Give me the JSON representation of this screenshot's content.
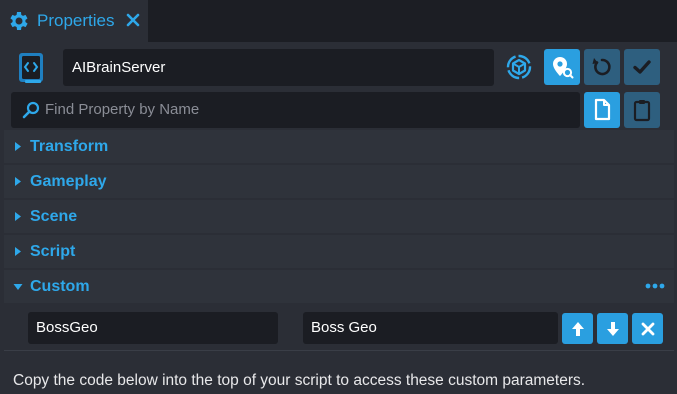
{
  "tab": {
    "title": "Properties",
    "icon": "gear-icon",
    "accent": "#2ea8ea"
  },
  "object": {
    "name": "AIBrainServer",
    "icon": "script-icon"
  },
  "toolbar": {
    "buttons": [
      {
        "icon": "locate-pin-icon",
        "state": "active"
      },
      {
        "icon": "reset-icon",
        "state": "dim"
      },
      {
        "icon": "checkmark-icon",
        "state": "dim"
      }
    ],
    "search_buttons": [
      {
        "icon": "copy-icon",
        "state": "active"
      },
      {
        "icon": "paste-icon",
        "state": "dim"
      }
    ]
  },
  "search": {
    "placeholder": "Find Property by Name"
  },
  "sections": [
    {
      "label": "Transform",
      "expanded": false
    },
    {
      "label": "Gameplay",
      "expanded": false
    },
    {
      "label": "Scene",
      "expanded": false
    },
    {
      "label": "Script",
      "expanded": false
    },
    {
      "label": "Custom",
      "expanded": true
    }
  ],
  "custom": {
    "param_name": "BossGeo",
    "param_value": "Boss Geo",
    "buttons": [
      "arrow-up-icon",
      "arrow-down-icon",
      "close-icon"
    ]
  },
  "footer": {
    "text": "Copy the code below into the top of your script to access these custom parameters."
  },
  "colors": {
    "background": "#2b2e36",
    "tabbar": "#1c1e24",
    "field": "#1b1d23",
    "section": "#2f333b",
    "accent": "#2ea8ea",
    "button_active": "#2a9fe0",
    "button_dim": "#2e5f7f"
  }
}
